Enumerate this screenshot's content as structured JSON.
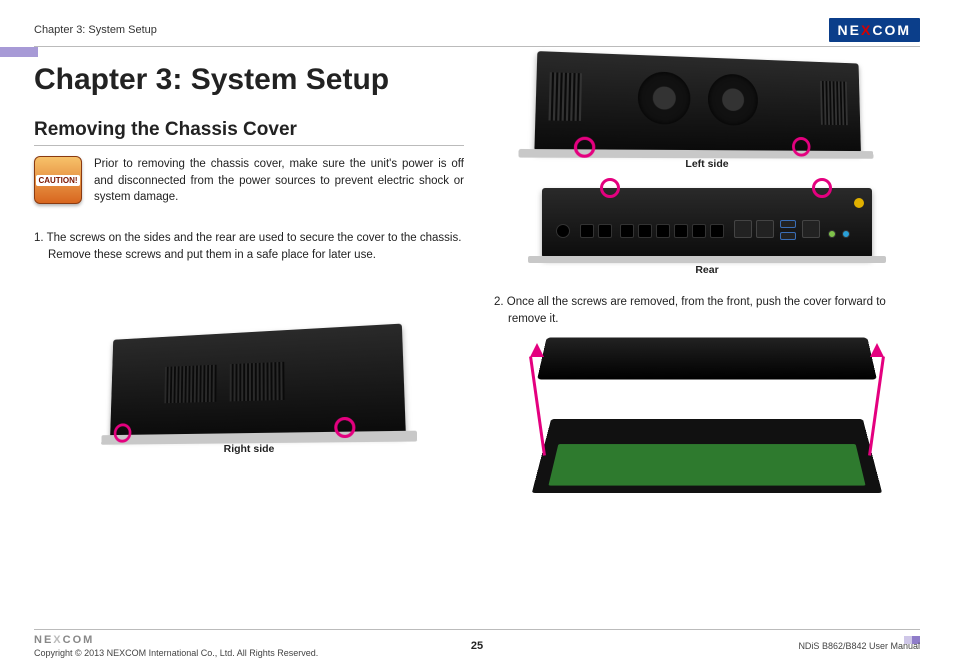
{
  "header": {
    "breadcrumb": "Chapter 3: System Setup",
    "brand_pre": "NE",
    "brand_x": "X",
    "brand_post": "COM"
  },
  "title": "Chapter 3: System Setup",
  "section_heading": "Removing the Chassis Cover",
  "caution": {
    "badge": "CAUTION!",
    "text": "Prior to removing the chassis cover, make sure the unit's power is off and disconnected from the power sources to prevent electric shock or system damage."
  },
  "steps": {
    "s1": "1.  The screws on the sides and the rear are used to secure the cover to the chassis. Remove these screws and put them in a safe place for later use.",
    "s2": "2.  Once all the screws are removed, from the front, push the cover forward to remove it."
  },
  "figures": {
    "right_side": "Right side",
    "left_side": "Left side",
    "rear": "Rear"
  },
  "footer": {
    "brand_pre": "NE",
    "brand_x": "X",
    "brand_post": "COM",
    "copyright": "Copyright © 2013 NEXCOM International Co., Ltd. All Rights Reserved.",
    "page": "25",
    "doc": "NDiS B862/B842 User Manual"
  },
  "colors": {
    "accent_pink": "#e4007f",
    "brand_blue": "#0b3e8a",
    "brand_red": "#d40000",
    "lavender": "#a79ad6"
  }
}
